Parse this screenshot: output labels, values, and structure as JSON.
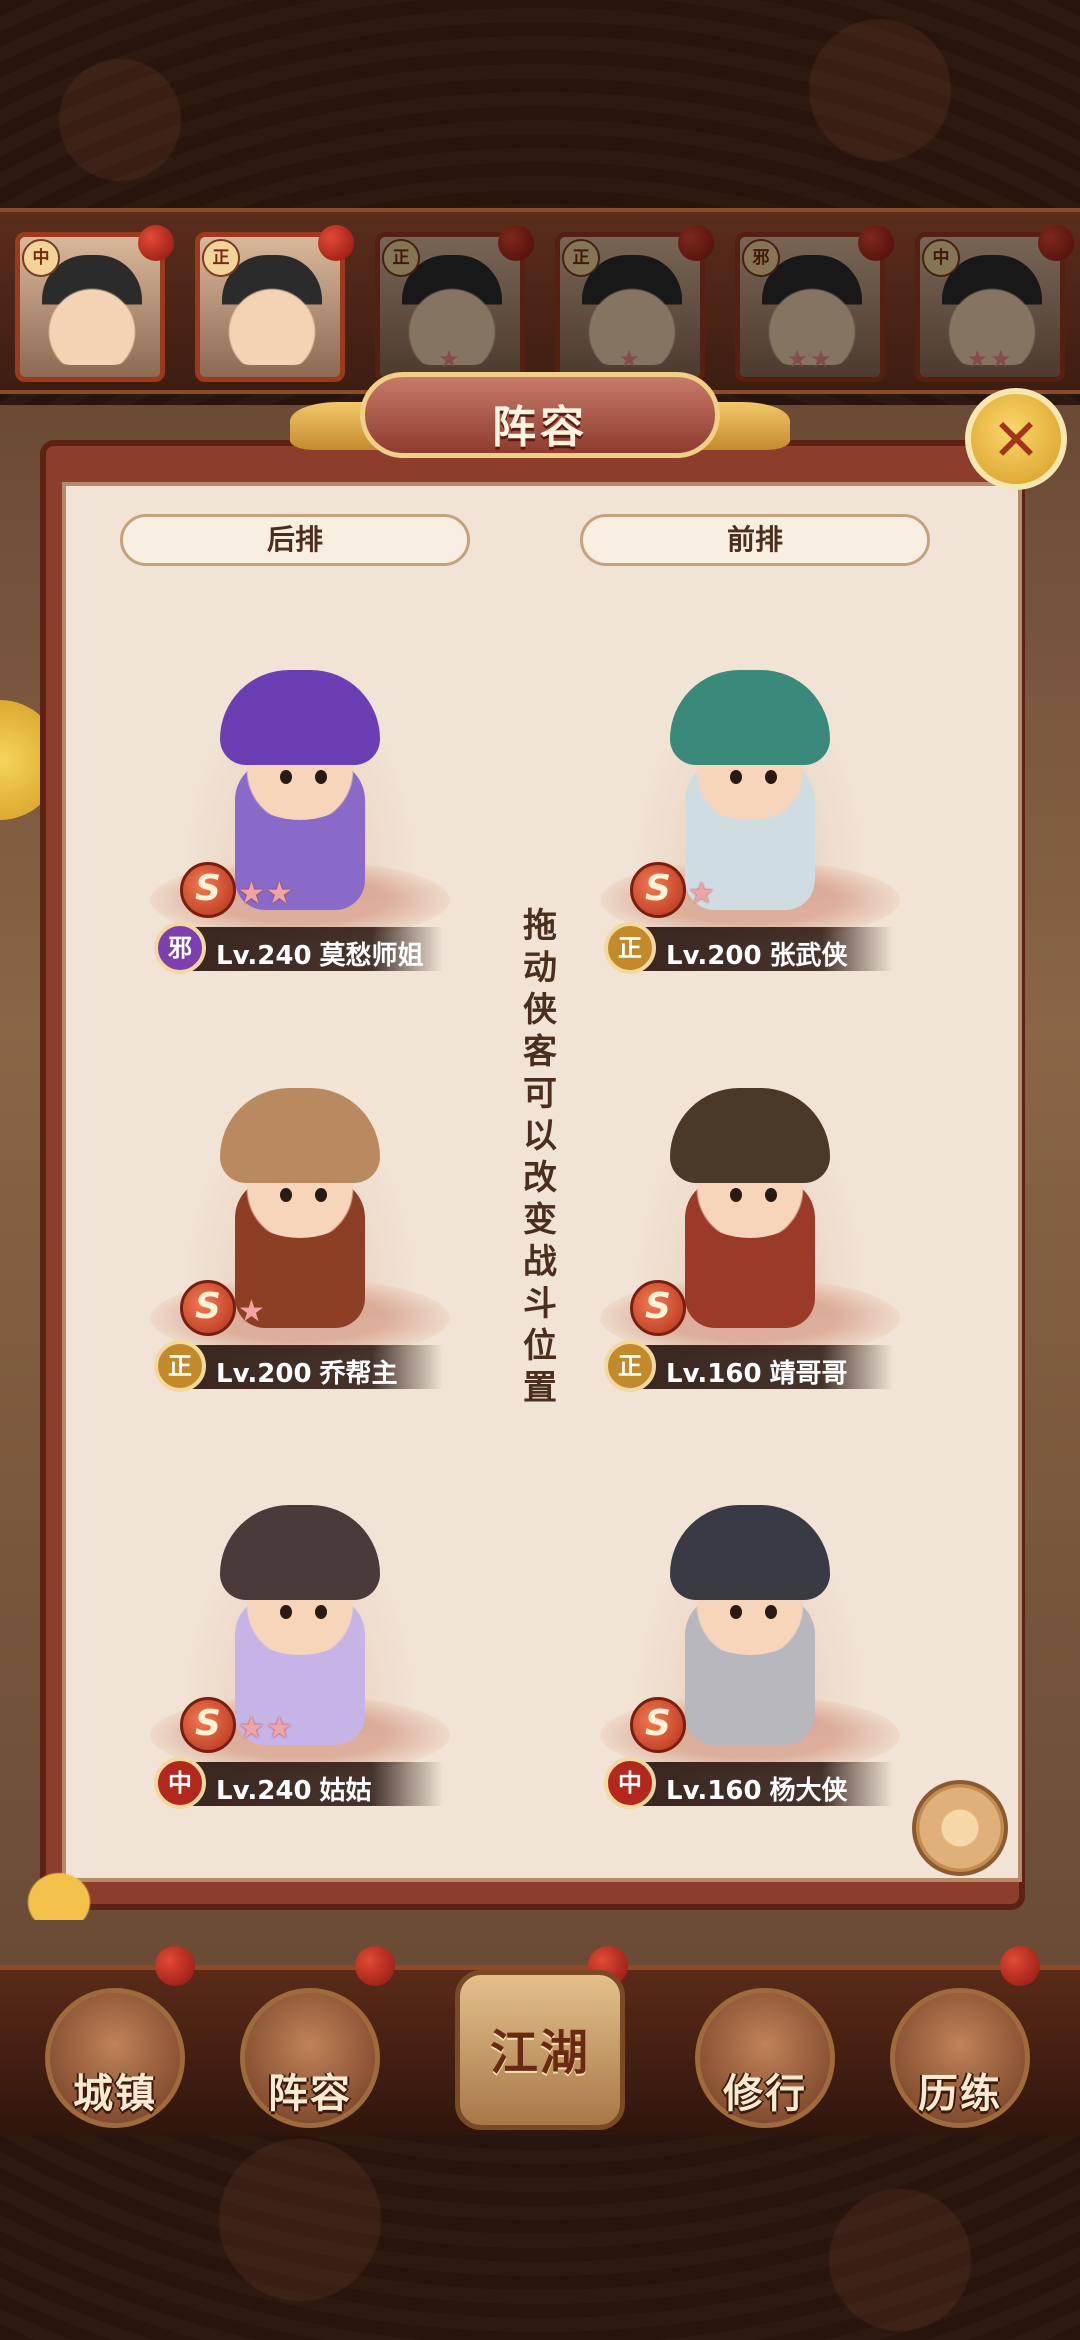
{
  "panel": {
    "title": "阵容",
    "col_back": "后排",
    "col_front": "前排",
    "hint": "拖动侠客可以改变战斗位置"
  },
  "roster": [
    {
      "faction": "中",
      "stars": ""
    },
    {
      "faction": "正",
      "stars": ""
    },
    {
      "faction": "正",
      "stars": "★"
    },
    {
      "faction": "正",
      "stars": "★"
    },
    {
      "faction": "邪",
      "stars": "★★"
    },
    {
      "faction": "中",
      "stars": "★★"
    }
  ],
  "heroes": [
    {
      "faction": "邪",
      "level": "Lv.240",
      "name": "莫愁师姐",
      "stars": "★★",
      "hair": "#6b3fb3",
      "body": "#8a6ac8",
      "faction_color": "#7b3fb0"
    },
    {
      "faction": "正",
      "level": "Lv.200",
      "name": "张武侠",
      "stars": "★",
      "hair": "#3a8a7c",
      "body": "#cfdde3",
      "faction_color": "#c28a2a"
    },
    {
      "faction": "正",
      "level": "Lv.200",
      "name": "乔帮主",
      "stars": "★",
      "hair": "#b98a60",
      "body": "#8c3f25",
      "faction_color": "#c28a2a"
    },
    {
      "faction": "正",
      "level": "Lv.160",
      "name": "靖哥哥",
      "stars": "",
      "hair": "#4a3828",
      "body": "#9c3a2a",
      "faction_color": "#c28a2a"
    },
    {
      "faction": "中",
      "level": "Lv.240",
      "name": "姑姑",
      "stars": "★★",
      "hair": "#4a3a3a",
      "body": "#c7b4e6",
      "faction_color": "#b3271c"
    },
    {
      "faction": "中",
      "level": "Lv.160",
      "name": "杨大侠",
      "stars": "",
      "hair": "#3a3a44",
      "body": "#b7b7bd",
      "faction_color": "#b3271c"
    }
  ],
  "nav": {
    "town": "城镇",
    "lineup": "阵容",
    "jianghu": "江湖",
    "cultivate": "修行",
    "training": "历练"
  },
  "icons": {
    "close": "crossed-swords-icon",
    "settings": "flower-icon",
    "rank": "s-rank-icon"
  }
}
